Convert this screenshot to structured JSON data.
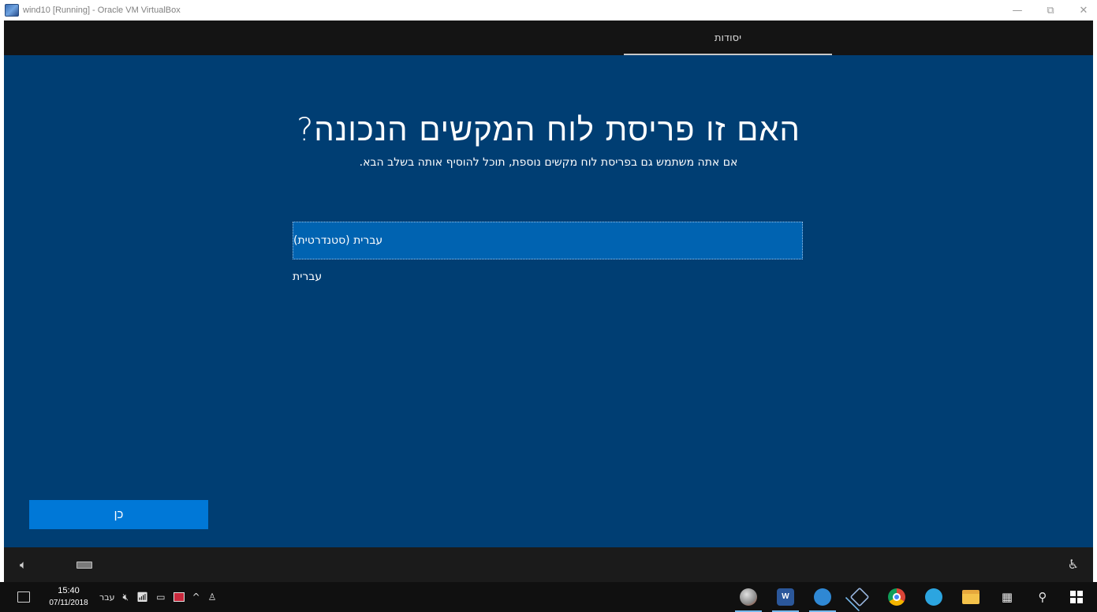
{
  "window": {
    "title": "wind10 [Running] - Oracle VM VirtualBox",
    "controls": {
      "minimize": "—",
      "restore": "⧉",
      "close": "✕"
    }
  },
  "oobe": {
    "tab_label": "יסודות",
    "heading": "האם זו פריסת לוח המקשים הנכונה?",
    "subheading": "אם אתה משתמש גם בפריסת לוח מקשים נוספת, תוכל להוסיף אותה בשלב הבא.",
    "options": [
      {
        "label": "עברית (סטנדרטית)",
        "selected": true
      },
      {
        "label": "עברית",
        "selected": false
      }
    ],
    "yes_button": "כן",
    "bottom_icons": {
      "volume": "speaker-icon",
      "keyboard": "keyboard-icon",
      "accessibility": "ease-of-access-icon"
    }
  },
  "taskbar": {
    "time": "15:40",
    "date": "07/11/2018",
    "language": "עבר",
    "tray_icons": [
      "mute-icon",
      "wifi-icon",
      "battery-icon",
      "alert-icon",
      "chevron-up-icon",
      "people-icon"
    ],
    "apps": [
      "app-icon",
      "word-icon",
      "telegram-desktop-icon",
      "virtualbox-icon",
      "chrome-icon",
      "telegram-icon",
      "file-explorer-icon"
    ],
    "task_view_icon": "task-view-icon",
    "search_icon": "search-icon",
    "start_icon": "windows-start-icon"
  },
  "colors": {
    "oobe_background": "#003e73",
    "selected_option": "#0063b1",
    "primary_button": "#0078d7",
    "topbar": "#141414",
    "taskbar": "#101010"
  }
}
